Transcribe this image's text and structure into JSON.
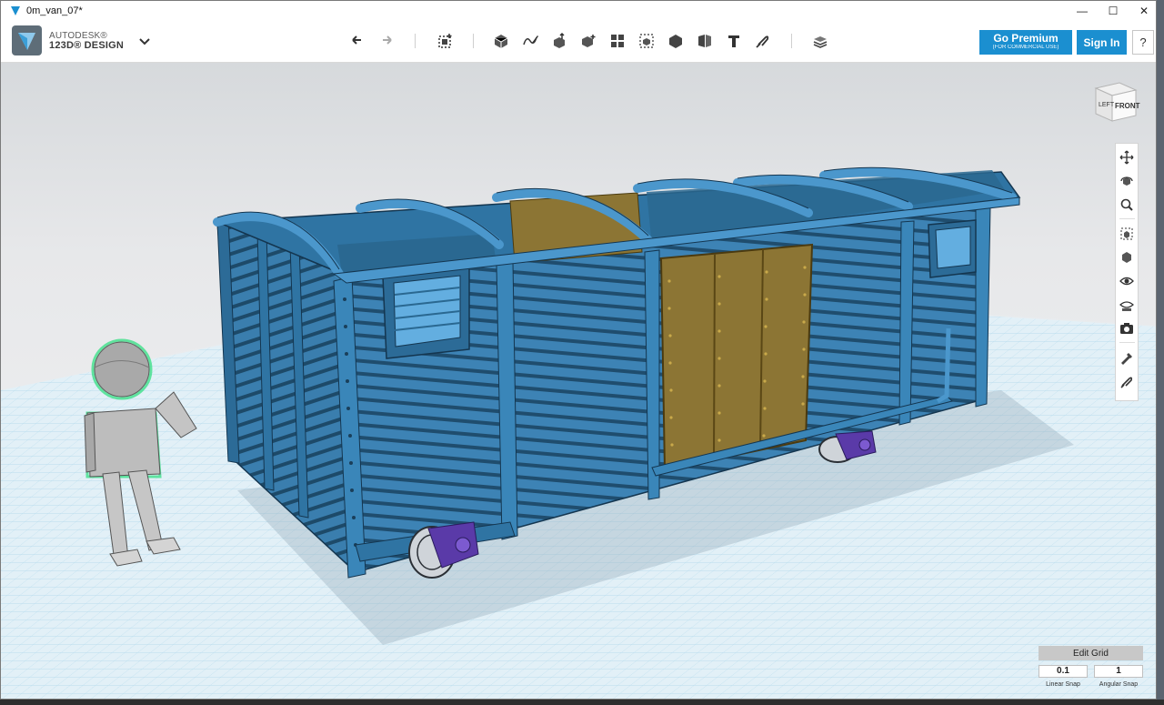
{
  "window": {
    "title": "0m_van_07*"
  },
  "brand": {
    "line1": "AUTODESK®",
    "line2": "123D® DESIGN"
  },
  "toolbar": {
    "tools": [
      {
        "name": "undo-icon"
      },
      {
        "name": "redo-icon"
      },
      {
        "name": "transform-icon"
      },
      {
        "name": "primitives-icon"
      },
      {
        "name": "sketch-icon"
      },
      {
        "name": "construct-icon"
      },
      {
        "name": "modify-icon"
      },
      {
        "name": "pattern-icon"
      },
      {
        "name": "grouping-icon"
      },
      {
        "name": "combine-icon"
      },
      {
        "name": "measure-icon"
      },
      {
        "name": "text-icon"
      },
      {
        "name": "snap-icon"
      },
      {
        "name": "material-icon"
      }
    ],
    "premium_label": "Go Premium",
    "premium_sub": "(FOR COMMERCIAL USE)",
    "signin_label": "Sign In",
    "help_label": "?"
  },
  "viewcube": {
    "left_label": "LEFT",
    "front_label": "FRONT"
  },
  "nav_panel": {
    "items": [
      "pan-icon",
      "orbit-icon",
      "zoom-icon",
      "fit-icon",
      "view-mode-icon",
      "visibility-icon",
      "materials-view-icon",
      "screenshot-icon",
      "edit-grid-icon",
      "snap-toggle-icon"
    ]
  },
  "edit_grid": {
    "title": "Edit Grid",
    "linear_value": "0.1",
    "angular_value": "1",
    "linear_label": "Linear Snap",
    "angular_label": "Angular Snap"
  },
  "colors": {
    "accent": "#1b8fd0",
    "body_blue": "#3f87b9",
    "door_brown": "#8b7232",
    "grid": "#9fd0e8",
    "wheel_purple": "#5a3aa8"
  }
}
